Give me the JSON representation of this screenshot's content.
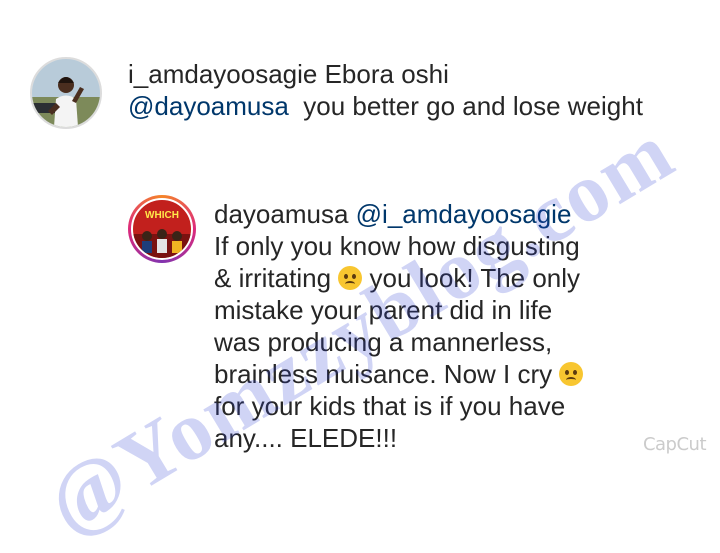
{
  "comments": [
    {
      "username": "i_amdayoosagie",
      "text_lead": "Ebora oshi",
      "mention": "@dayoamusa",
      "text_rest": "  you better go and lose weight"
    },
    {
      "username": "dayoamusa",
      "mention": "@i_amdayoosagie",
      "line1": "If only you know how disgusting",
      "line2a": "& irritating",
      "line2b": " you look! The only",
      "line3": "mistake your parent did in life",
      "line4": "was producing a mannerless,",
      "line5a": "brainless nuisance.  Now I cry",
      "line6": "for your kids that is if you have",
      "line7": "any.... ELEDE!!!"
    }
  ],
  "avatar_2_poster_text": "WHICH ",
  "watermark": "@Yomzzyblog.com",
  "capcut_mark": "CapCut",
  "emojis": [
    "angry-face-emoji",
    "frowning-face-emoji"
  ]
}
